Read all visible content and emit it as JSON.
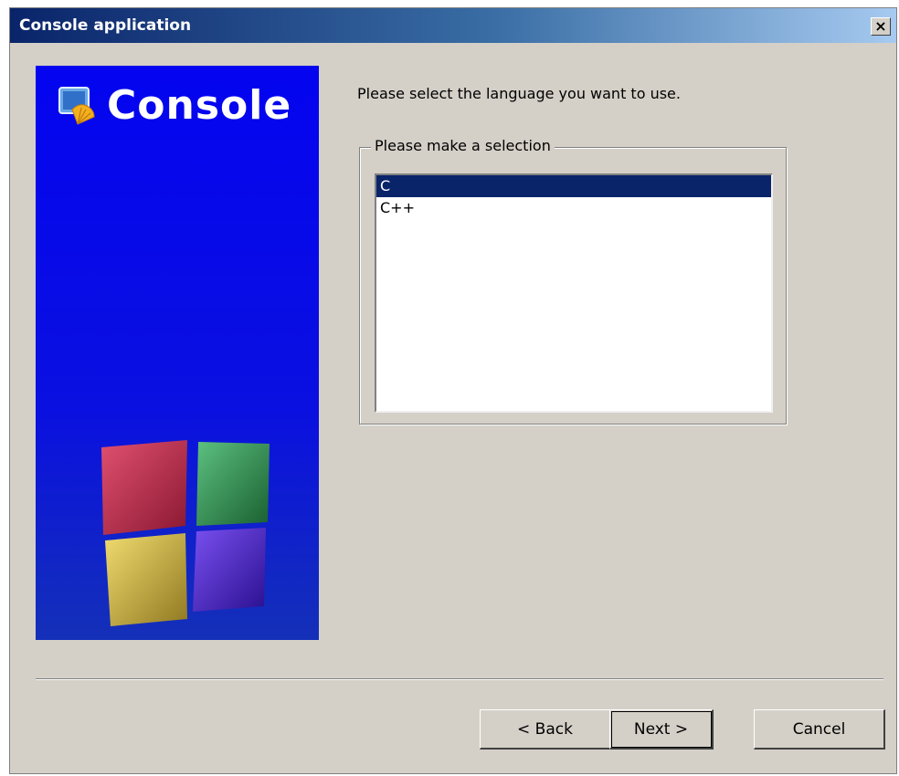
{
  "window": {
    "title": "Console application",
    "close_glyph": "×"
  },
  "side_panel": {
    "logo_text": "Console",
    "logo_icon": "codeblocks-shell-icon",
    "illustration": "colored-cubes-logo",
    "colors": {
      "background": "#0404f0",
      "cube_red": "#c0304a",
      "cube_green": "#2e8b4a",
      "cube_yellow": "#c9b03a",
      "cube_purple": "#4a2ac0"
    }
  },
  "main": {
    "prompt": "Please select the language you want to use.",
    "group_label": "Please make a selection",
    "languages": [
      {
        "label": "C",
        "selected": true
      },
      {
        "label": "C++",
        "selected": false
      }
    ]
  },
  "buttons": {
    "back": "< Back",
    "next": "Next >",
    "cancel": "Cancel"
  },
  "colors": {
    "window_bg": "#d4d0c8",
    "titlebar_start": "#0a246a",
    "titlebar_end": "#a6caf0",
    "selection_bg": "#0a246a"
  }
}
